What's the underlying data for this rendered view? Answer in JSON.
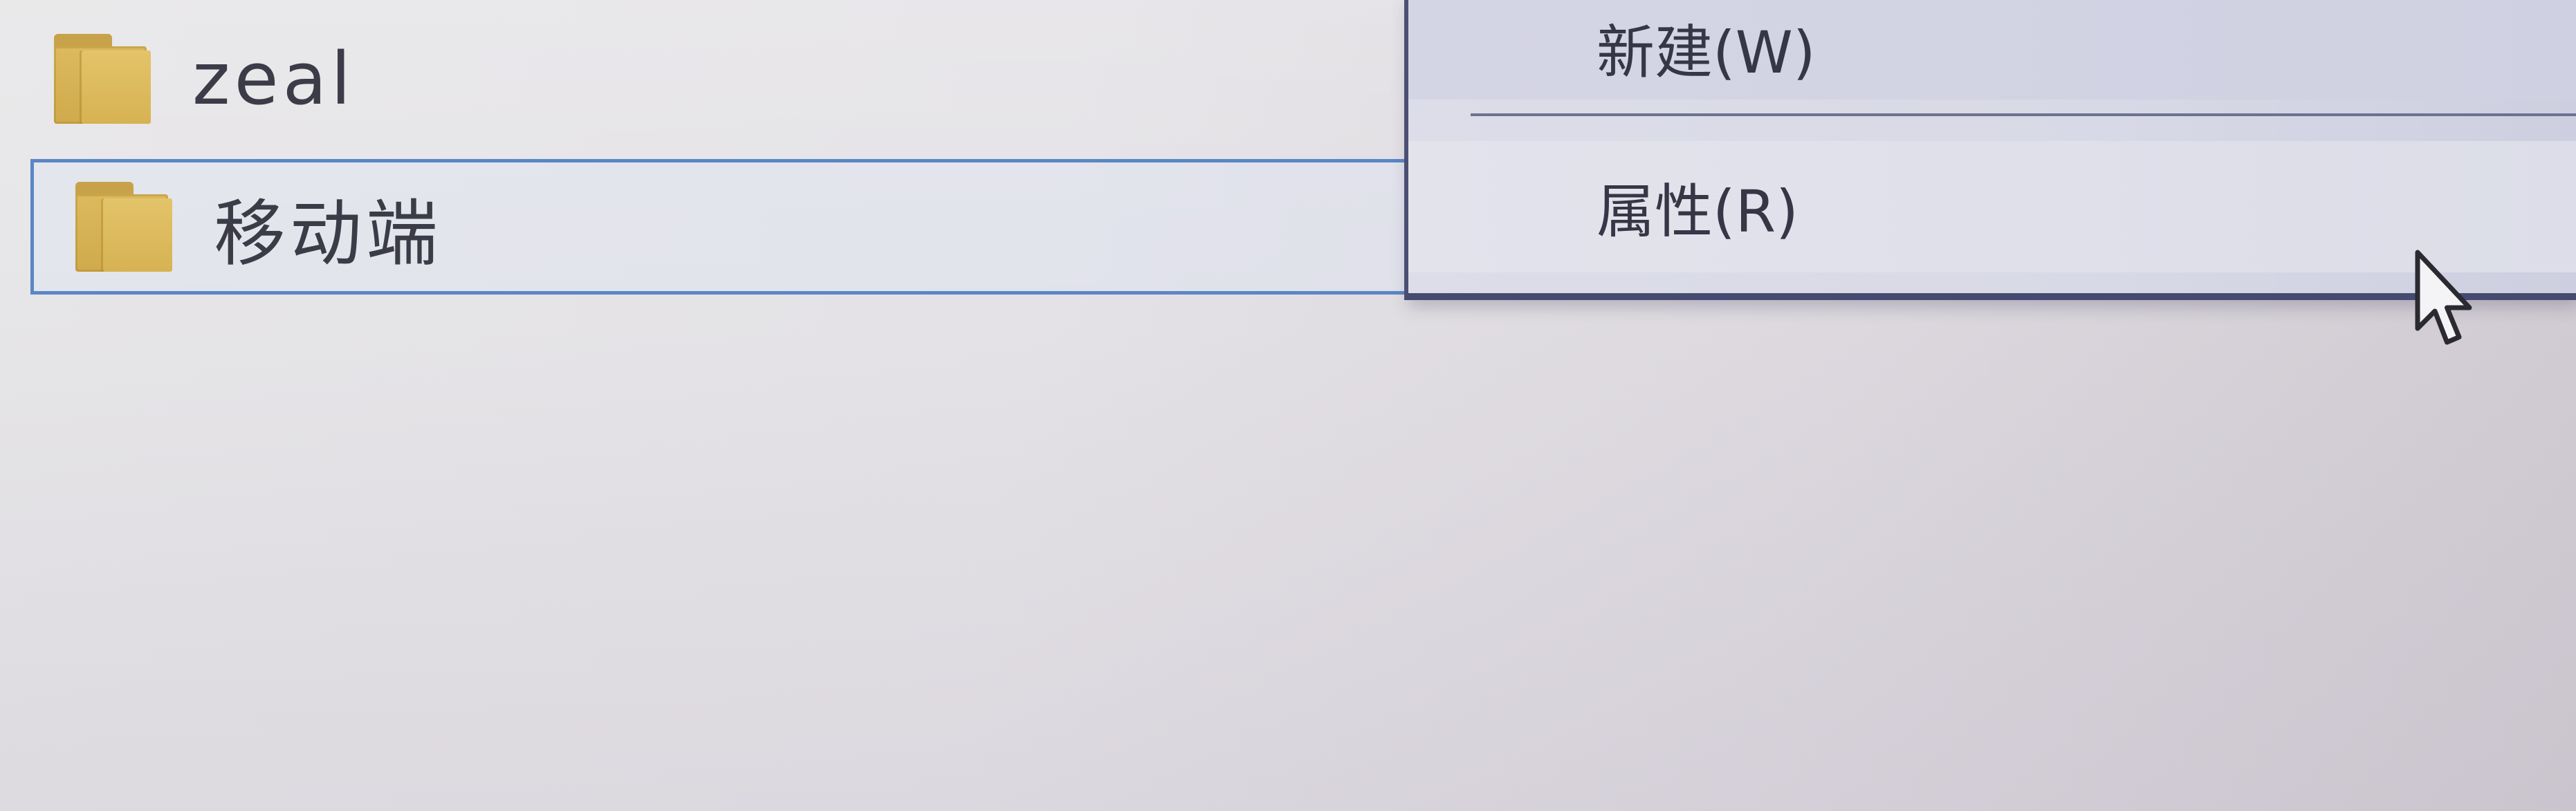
{
  "file_list": {
    "items": [
      {
        "name": "zeal",
        "icon": "folder-icon",
        "selected": false
      },
      {
        "name": "移动端",
        "icon": "folder-icon",
        "selected": true
      }
    ]
  },
  "context_menu": {
    "items": [
      {
        "label": "新建(W)"
      },
      {
        "label": "属性(R)"
      }
    ]
  },
  "colors": {
    "selection_border": "#5a86c6",
    "folder": "#d6b252",
    "menu_border": "#454a70"
  }
}
